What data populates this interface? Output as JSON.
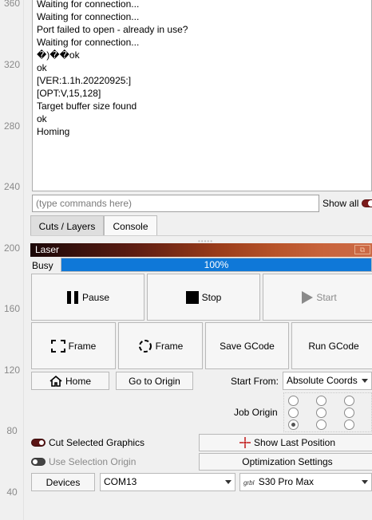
{
  "ruler": {
    "ticks": [
      {
        "label": "360"
      },
      {
        "label": "320"
      },
      {
        "label": "280"
      },
      {
        "label": "240"
      },
      {
        "label": "200"
      },
      {
        "label": "160"
      },
      {
        "label": "120"
      },
      {
        "label": "80"
      },
      {
        "label": "40"
      }
    ]
  },
  "console": {
    "lines": [
      "Waiting for connection...",
      "Waiting for connection...",
      "Port failed to open - already in use?",
      "Waiting for connection...",
      "�)��ok",
      "ok",
      "[VER:1.1h.20220925:]",
      "[OPT:V,15,128]",
      "Target buffer size found",
      "ok",
      "Homing"
    ]
  },
  "command": {
    "placeholder": "(type commands here)",
    "value": ""
  },
  "show_all": {
    "label": "Show all"
  },
  "tabs": [
    {
      "label": "Cuts / Layers",
      "active": true
    },
    {
      "label": "Console",
      "active": false
    }
  ],
  "laser_panel": {
    "title": "Laser",
    "status": "Busy",
    "progress_text": "100%",
    "progress_fraction": 1.0
  },
  "buttons": {
    "pause": "Pause",
    "stop": "Stop",
    "start": "Start",
    "frame1": "Frame",
    "frame2": "Frame",
    "save_gcode": "Save GCode",
    "run_gcode": "Run GCode",
    "home": "Home",
    "go_to_origin": "Go to Origin",
    "show_last_position": "Show Last Position",
    "optimization_settings": "Optimization Settings",
    "devices": "Devices"
  },
  "start_from": {
    "label": "Start From:",
    "value": "Absolute Coords"
  },
  "job_origin": {
    "label": "Job Origin",
    "selected_index": 6
  },
  "options": {
    "cut_selected_graphics": "Cut Selected Graphics",
    "use_selection_origin": "Use Selection Origin"
  },
  "port": {
    "value": "COM13"
  },
  "device": {
    "prefix": "grbl",
    "value": "S30 Pro Max"
  },
  "colors": {
    "accent": "#0f78d8",
    "laser_header_dark": "#1a0707",
    "laser_header_light": "#cc6a46"
  }
}
